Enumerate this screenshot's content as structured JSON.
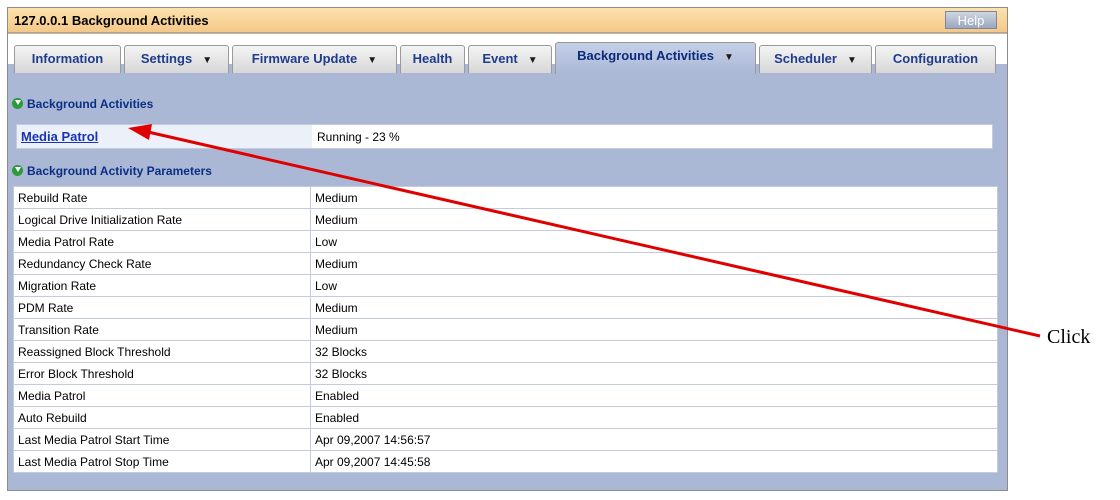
{
  "window": {
    "title": "127.0.0.1 Background Activities",
    "help_label": "Help"
  },
  "tabs": [
    {
      "label": "Information",
      "dropdown": false
    },
    {
      "label": "Settings",
      "dropdown": true
    },
    {
      "label": "Firmware Update",
      "dropdown": true
    },
    {
      "label": "Health",
      "dropdown": false
    },
    {
      "label": "Event",
      "dropdown": true
    },
    {
      "label": "Background Activities",
      "dropdown": true,
      "active": true
    },
    {
      "label": "Scheduler",
      "dropdown": true
    },
    {
      "label": "Configuration",
      "dropdown": false
    }
  ],
  "background_activities": {
    "heading": "Background Activities",
    "media_patrol_link": "Media Patrol",
    "media_patrol_status": "Running - 23 %"
  },
  "parameters": {
    "heading": "Background Activity Parameters",
    "rows": [
      {
        "name": "Rebuild Rate",
        "value": "Medium"
      },
      {
        "name": "Logical Drive Initialization Rate",
        "value": "Medium"
      },
      {
        "name": "Media Patrol Rate",
        "value": "Low"
      },
      {
        "name": "Redundancy Check Rate",
        "value": "Medium"
      },
      {
        "name": "Migration Rate",
        "value": "Low"
      },
      {
        "name": "PDM Rate",
        "value": "Medium"
      },
      {
        "name": "Transition Rate",
        "value": "Medium"
      },
      {
        "name": "Reassigned Block Threshold",
        "value": "32 Blocks"
      },
      {
        "name": "Error Block Threshold",
        "value": "32 Blocks"
      },
      {
        "name": "Media Patrol",
        "value": "Enabled"
      },
      {
        "name": "Auto Rebuild",
        "value": "Enabled"
      },
      {
        "name": "Last Media Patrol Start Time",
        "value": "Apr 09,2007 14:56:57"
      },
      {
        "name": "Last Media Patrol Stop Time",
        "value": "Apr 09,2007 14:45:58"
      }
    ]
  },
  "annotation": {
    "text": "Click",
    "color": "#e00000"
  },
  "colors": {
    "title_bar": "#f4c887",
    "panel": "#aab8d6",
    "tab_text": "#1f3d8c",
    "link": "#1833b6"
  }
}
